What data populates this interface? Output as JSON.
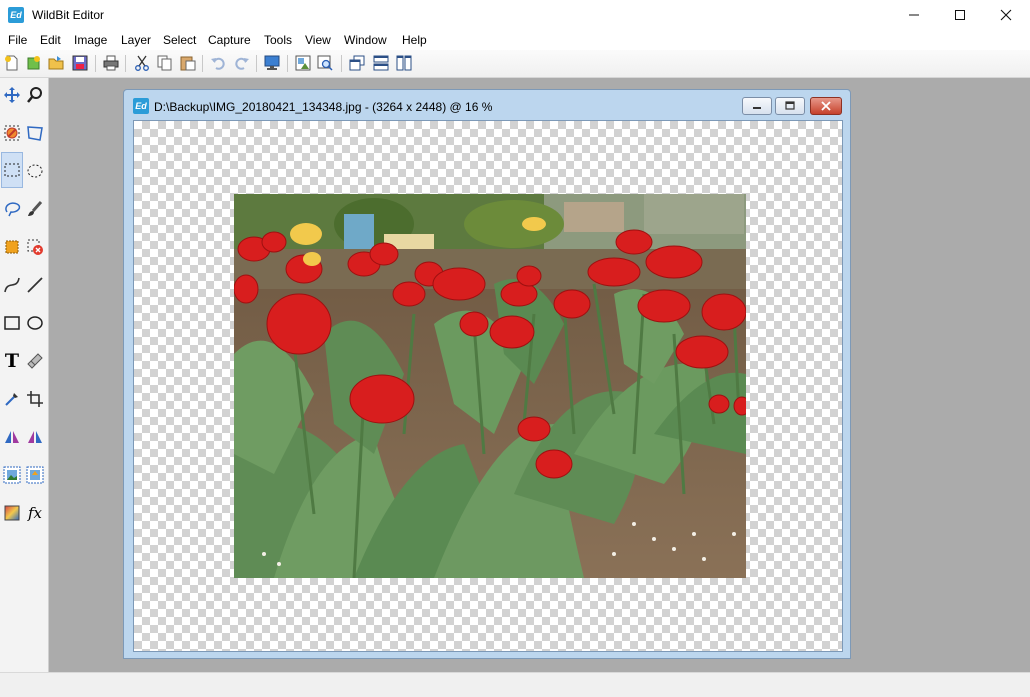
{
  "app": {
    "title": "WildBit Editor",
    "icon_text": "Ed"
  },
  "window_controls": {
    "minimize": "—",
    "maximize": "☐",
    "close": "✕"
  },
  "menu": [
    "File",
    "Edit",
    "Image",
    "Layer",
    "Select",
    "Capture",
    "Tools",
    "View",
    "Window",
    "Help"
  ],
  "toolbar": {
    "buttons": [
      "new-icon",
      "open-icon",
      "open-folder-icon",
      "save-icon",
      "print-icon",
      "cut-icon",
      "copy-icon",
      "paste-icon",
      "undo-icon",
      "redo-icon",
      "screen-capture-icon",
      "image-properties-icon",
      "zoom-window-icon",
      "cascade-windows-icon",
      "tile-horizontal-icon",
      "tile-vertical-icon"
    ]
  },
  "toolbox": {
    "tools": [
      "move-icon",
      "zoom-icon",
      "deselect-icon",
      "transform-icon",
      "rect-select-icon",
      "ellipse-select-icon",
      "lasso-icon",
      "brush-icon",
      "crop-select-icon",
      "clear-selection-icon",
      "curve-icon",
      "line-icon",
      "rectangle-icon",
      "ellipse-icon",
      "text-icon",
      "eraser-icon",
      "eyedropper-icon",
      "crop-icon",
      "flip-icon",
      "mirror-icon",
      "layer-image-icon",
      "layer-adjust-icon",
      "gradient-icon",
      "fx-icon"
    ],
    "text_tool": "T",
    "fx_tool": "fx",
    "active_tool": "rect-select-icon"
  },
  "document": {
    "icon_text": "Ed",
    "title": "D:\\Backup\\IMG_20180421_134348.jpg - (3264 x 2448) @ 16  %"
  },
  "colors": {
    "workspace": "#ababab",
    "child_frame": "#bcd6ee",
    "tulip_red": "#d81e1e",
    "accent": "#2b9cd8"
  }
}
